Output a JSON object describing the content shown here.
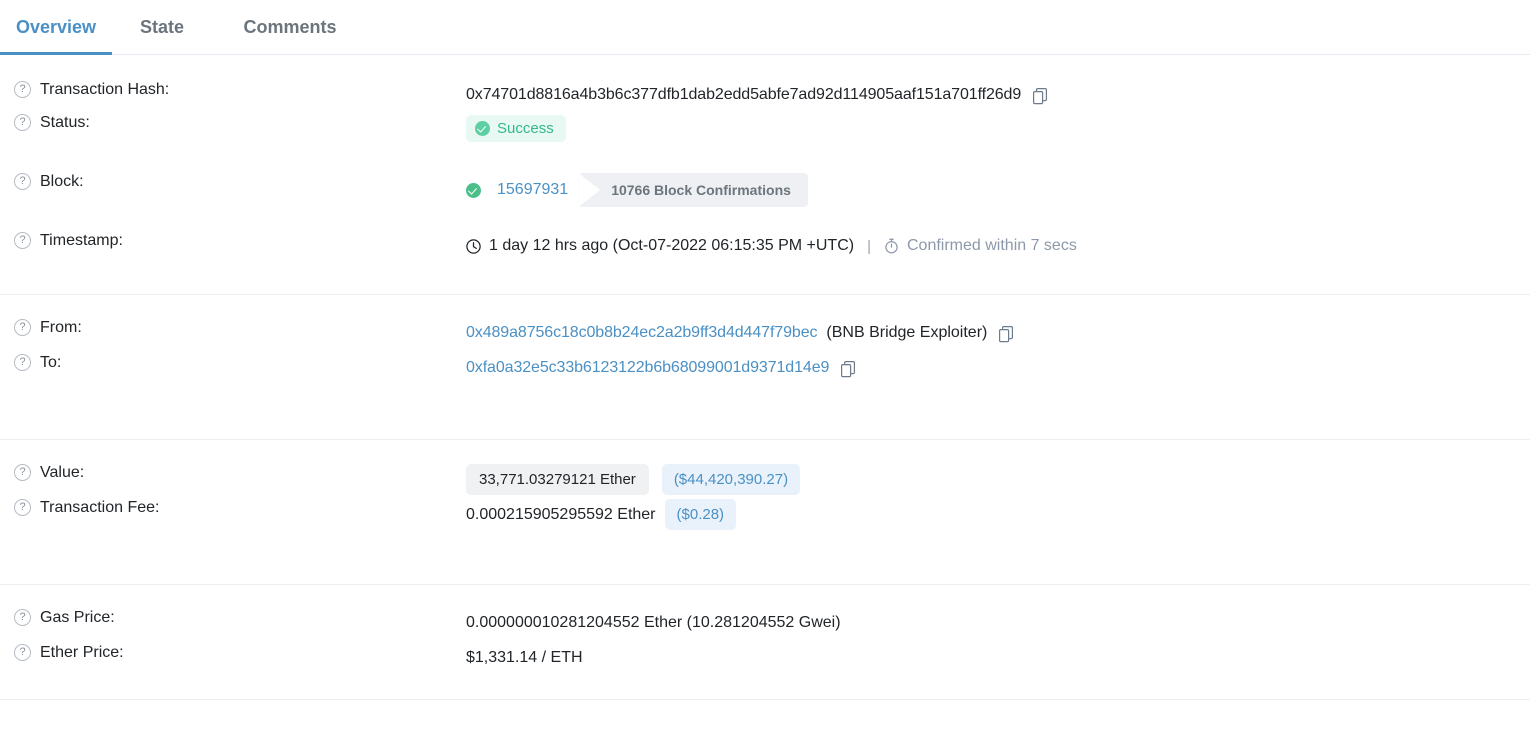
{
  "tabs": [
    {
      "label": "Overview",
      "active": true
    },
    {
      "label": "State",
      "active": false
    },
    {
      "label": "Comments",
      "active": false
    }
  ],
  "colors": {
    "accent_blue": "#4a90c4",
    "success_green": "#34b98a",
    "success_bg": "#e8f8f2",
    "pill_grey_bg": "#f0f1f3",
    "pill_blue_bg": "#e9f2fb",
    "muted_text": "#8d99a8",
    "divider": "#eceef2"
  },
  "rows": {
    "transaction_hash": {
      "label": "Transaction Hash:",
      "value": "0x74701d8816a4b3b6c377dfb1dab2edd5abfe7ad92d114905aaf151a701ff26d9",
      "copy_icon": "copy-icon"
    },
    "status": {
      "label": "Status:",
      "value": "Success",
      "icon": "check-circle-icon"
    },
    "block": {
      "label": "Block:",
      "number": "15697931",
      "confirmations": "10766 Block Confirmations",
      "icon": "check-circle-icon"
    },
    "timestamp": {
      "label": "Timestamp:",
      "clock_icon": "clock-icon",
      "value": "1 day 12 hrs ago (Oct-07-2022 06:15:35 PM +UTC)",
      "separator": "|",
      "stopwatch_icon": "stopwatch-icon",
      "confirmed": "Confirmed within 7 secs"
    },
    "from": {
      "label": "From:",
      "address": "0x489a8756c18c0b8b24ec2a2b9ff3d4d447f79bec",
      "tag": "(BNB Bridge Exploiter)",
      "copy_icon": "copy-icon"
    },
    "to": {
      "label": "To:",
      "address": "0xfa0a32e5c33b6123122b6b68099001d9371d14e9",
      "copy_icon": "copy-icon"
    },
    "value": {
      "label": "Value:",
      "ether": "33,771.03279121 Ether",
      "usd": "($44,420,390.27)"
    },
    "transaction_fee": {
      "label": "Transaction Fee:",
      "ether": "0.000215905295592 Ether",
      "usd": "($0.28)"
    },
    "gas_price": {
      "label": "Gas Price:",
      "value": "0.000000010281204552 Ether (10.281204552 Gwei)"
    },
    "ether_price": {
      "label": "Ether Price:",
      "value": "$1,331.14 / ETH"
    }
  }
}
